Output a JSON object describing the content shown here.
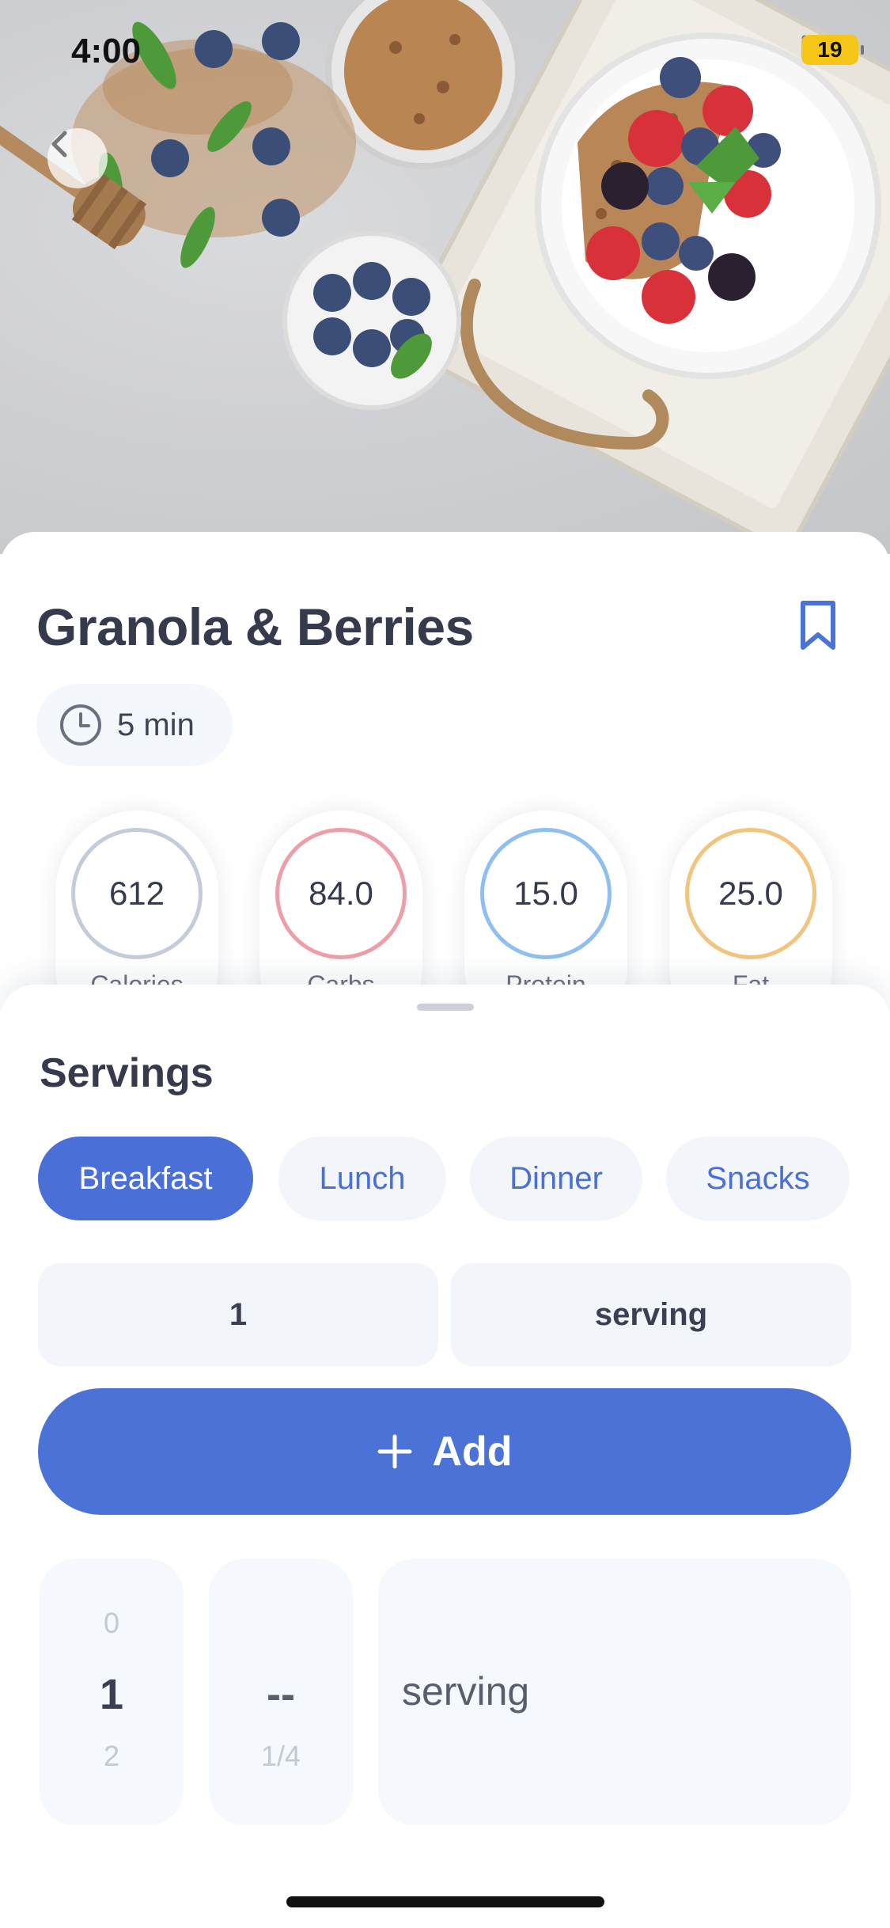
{
  "status_bar": {
    "time": "4:00",
    "battery": "19"
  },
  "recipe": {
    "title": "Granola & Berries",
    "time": "5 min",
    "macros": [
      {
        "value": "612",
        "label": "Calories",
        "color": "#c3ccd9"
      },
      {
        "value": "84.0",
        "label": "Carbs",
        "color": "#ee9ea8"
      },
      {
        "value": "15.0",
        "label": "Protein",
        "color": "#8fbff0"
      },
      {
        "value": "25.0",
        "label": "Fat",
        "color": "#f1c47f"
      }
    ]
  },
  "sheet": {
    "title": "Servings",
    "meal_tabs": [
      "Breakfast",
      "Lunch",
      "Dinner",
      "Snacks"
    ],
    "active_tab": "Breakfast",
    "quantity": "1",
    "unit": "serving",
    "add_label": "Add",
    "picker": {
      "whole": {
        "above": "0",
        "selected": "1",
        "below": "2"
      },
      "fraction": {
        "selected": "--",
        "below": "1/4"
      },
      "unit": "serving"
    }
  },
  "colors": {
    "accent": "#4b72d6",
    "field_bg": "#f2f6fb"
  }
}
